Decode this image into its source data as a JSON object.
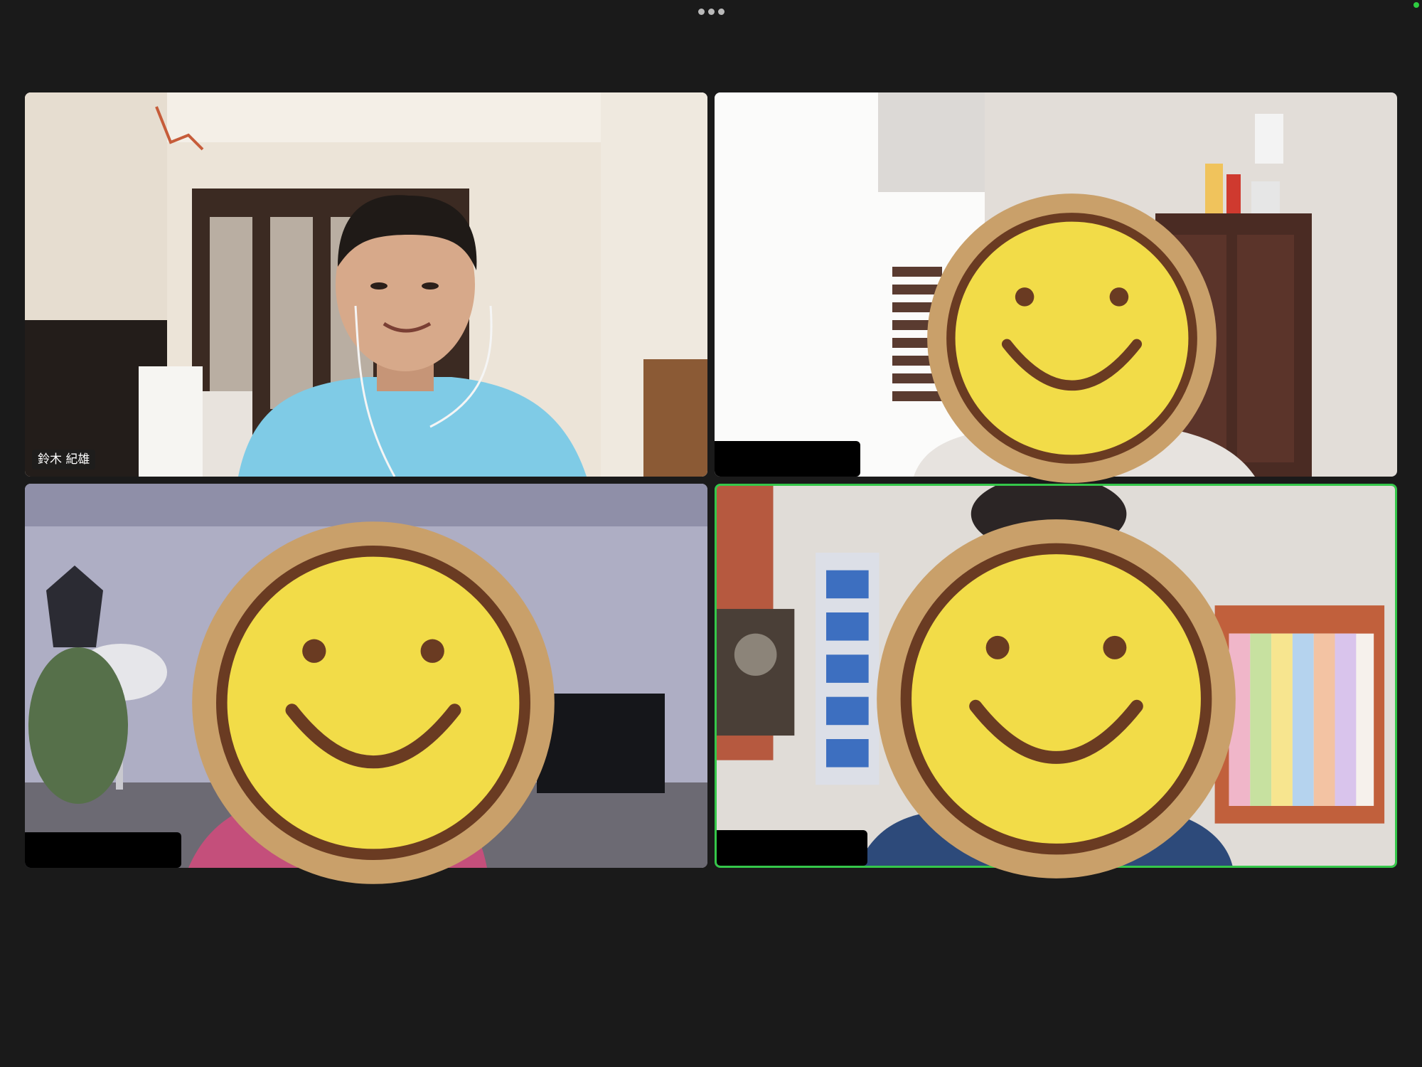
{
  "toolbar": {
    "more_icon": "ellipsis-icon"
  },
  "status_color": "#2ecc40",
  "active_speaker_color": "#35c74a",
  "participants": [
    {
      "name": "鈴木 紀雄",
      "video": "on",
      "face_covered": false
    },
    {
      "name": "",
      "video": "on",
      "face_covered": true,
      "name_redacted": true
    },
    {
      "name": "",
      "video": "on",
      "face_covered": true,
      "name_redacted": true
    },
    {
      "name": "",
      "video": "on",
      "face_covered": true,
      "name_redacted": true,
      "active_speaker": true
    }
  ],
  "sticker": {
    "icon": "smiley-face-icon",
    "face_color": "#f2dc48",
    "rim_color": "#c9a06a",
    "line_color": "#6a3b22"
  }
}
